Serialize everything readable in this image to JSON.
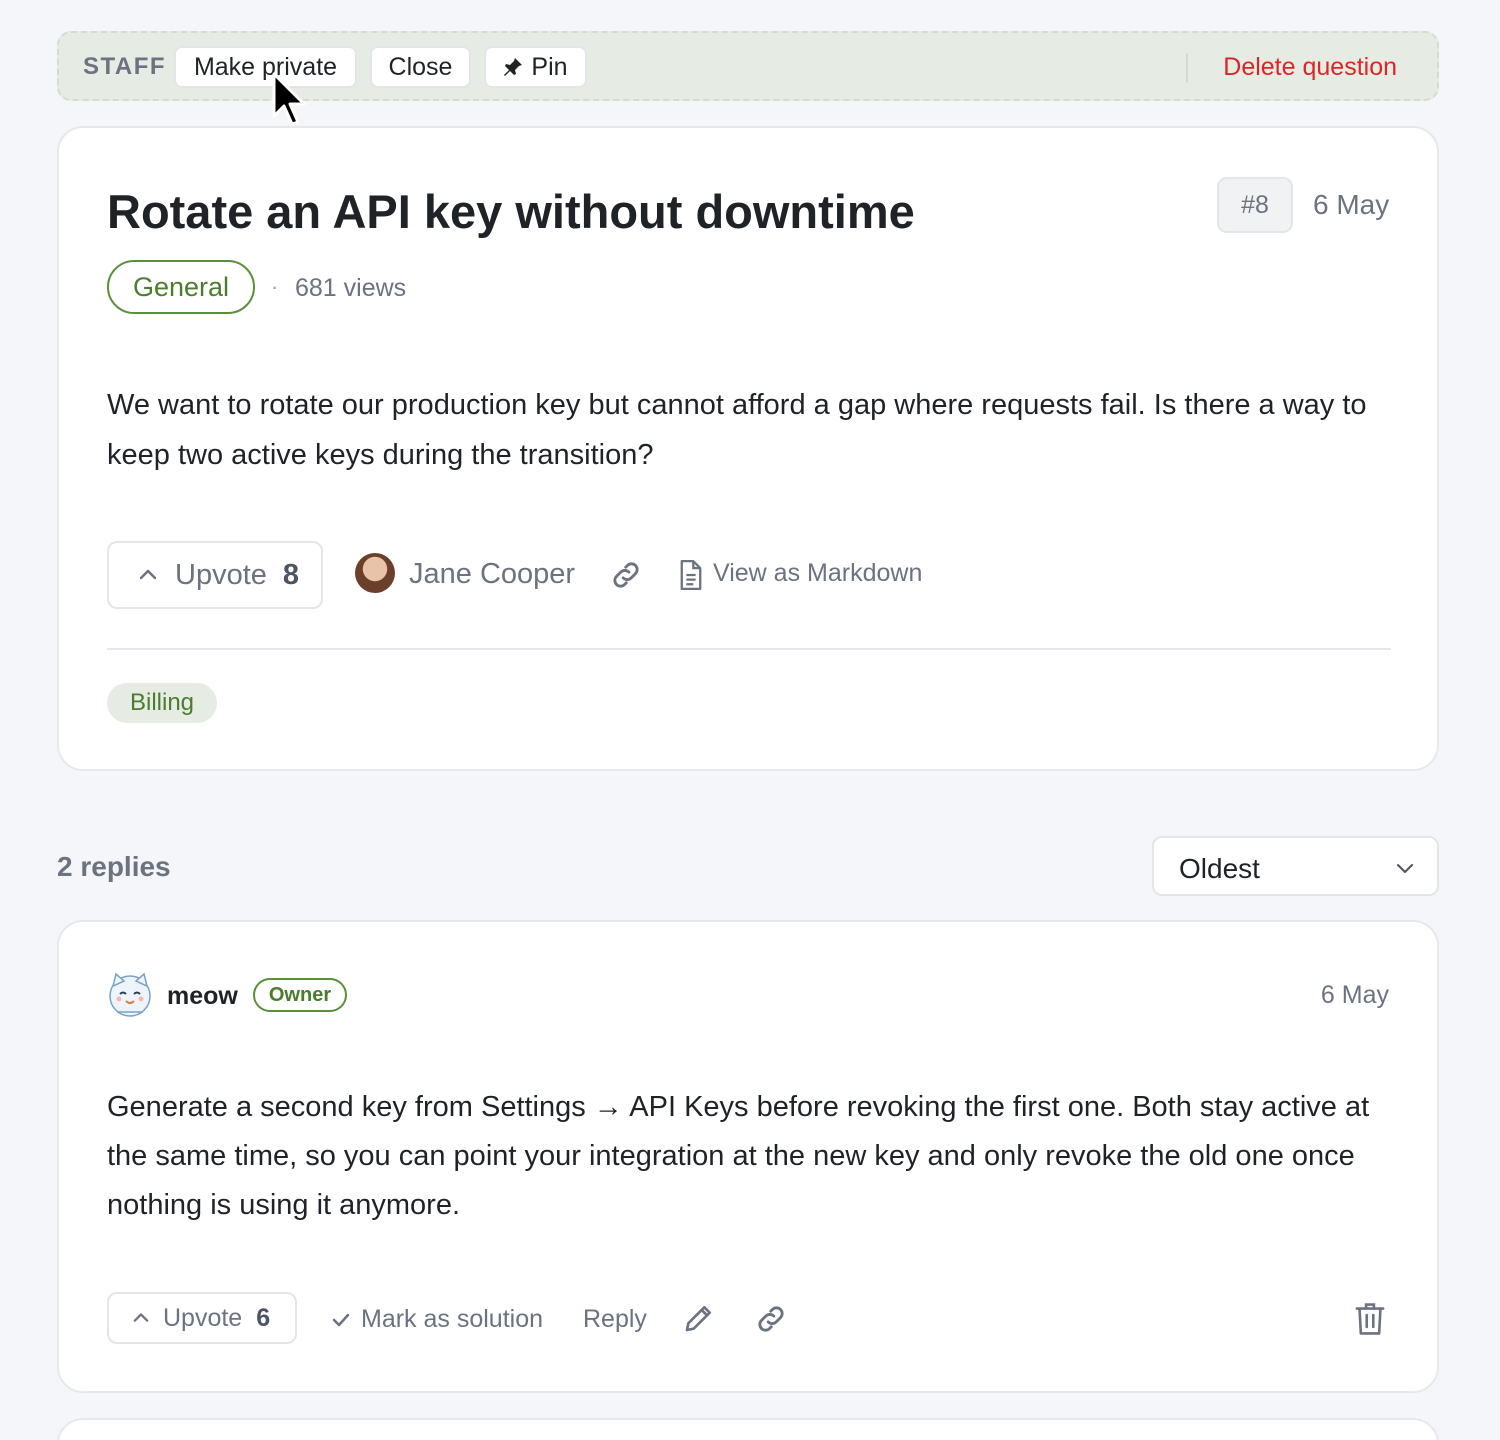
{
  "staff_bar": {
    "label": "STAFF",
    "make_private": "Make private",
    "close": "Close",
    "pin": "Pin",
    "delete": "Delete question"
  },
  "question": {
    "title": "Rotate an API key without downtime",
    "number": "#8",
    "date": "6 May",
    "category": "General",
    "separator": "·",
    "views": "681 views",
    "body": "We want to rotate our production key but cannot afford a gap where requests fail. Is there a way to keep two active keys during the transition?",
    "upvote_label": "Upvote",
    "upvote_count": "8",
    "author": "Jane Cooper",
    "markdown_link": "View as Markdown",
    "tag": "Billing"
  },
  "replies": {
    "count_label": "2 replies",
    "sort_value": "Oldest",
    "items": [
      {
        "author": "meow",
        "badge": "Owner",
        "date": "6 May",
        "body": "Generate a second key from Settings → API Keys before revoking the first one. Both stay active at the same time, so you can point your integration at the new key and only revoke the old one once nothing is using it anymore.",
        "upvote_label": "Upvote",
        "upvote_count": "6",
        "mark_solution": "Mark as solution",
        "reply": "Reply"
      }
    ]
  },
  "colors": {
    "accent_green": "#4c7d2e",
    "danger_red": "#dc2626",
    "staff_bar_bg": "#e6ebe3",
    "page_bg": "#f5f6fa"
  },
  "icons": [
    "pin-icon",
    "chevron-up-icon",
    "link-icon",
    "document-icon",
    "chevron-down-icon",
    "check-icon",
    "pencil-icon",
    "trash-icon",
    "cat-avatar-icon",
    "mouse-cursor-icon"
  ]
}
